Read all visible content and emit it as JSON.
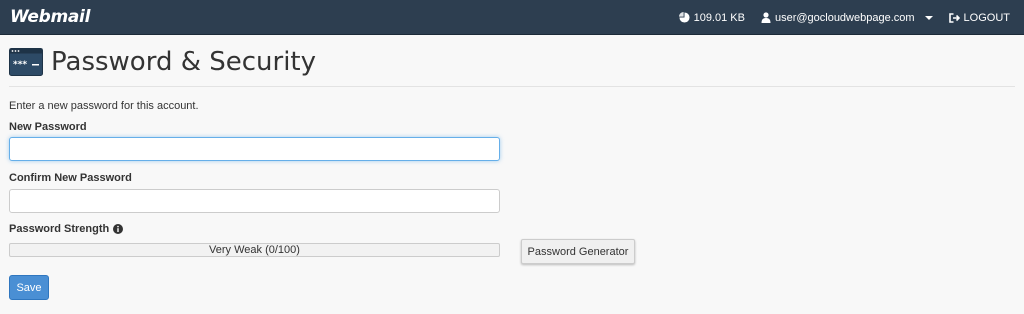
{
  "app": {
    "logo_text": "Webmail"
  },
  "topbar": {
    "disk_usage": "109.01 KB",
    "user": "user@gocloudwebpage.com",
    "logout_label": "LOGOUT"
  },
  "page": {
    "title": "Password & Security",
    "icon": "password-icon",
    "icon_text": "***"
  },
  "form": {
    "intro": "Enter a new password for this account.",
    "new_password_label": "New Password",
    "new_password_value": "",
    "confirm_password_label": "Confirm New Password",
    "confirm_password_value": "",
    "strength_label": "Password Strength",
    "strength_text": "Very Weak (0/100)",
    "strength_value": 0,
    "generator_label": "Password Generator",
    "save_label": "Save"
  },
  "colors": {
    "topbar": "#2d3e50",
    "primary_button": "#4a8fd4",
    "focus_border": "#66afe9"
  }
}
